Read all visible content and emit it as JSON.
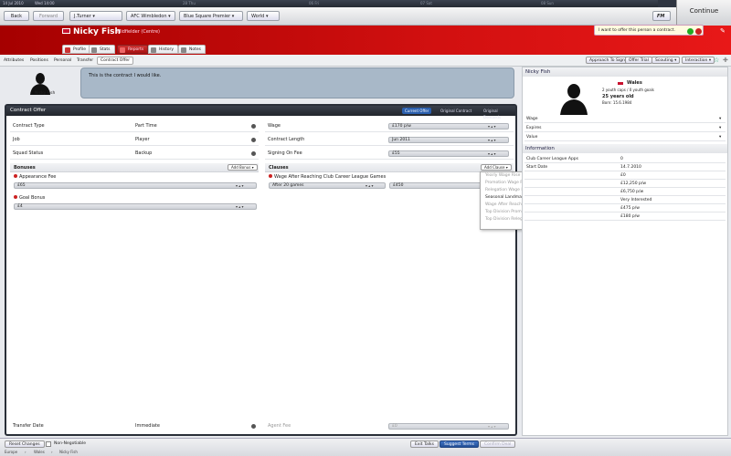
{
  "topbar": {
    "date": "14 Jul 2010",
    "time": "Wed 14:00",
    "timeline": [
      "28 Thu",
      "06 Fri",
      "07 Sat",
      "08 Sun"
    ]
  },
  "nav": {
    "back": "Back",
    "forward": "Forward",
    "manager": "J.Turner",
    "club": "AFC Wimbledon",
    "league": "Blue Square Premier",
    "world": "World",
    "fm_menu": "FM",
    "continue": "Continue"
  },
  "player": {
    "name": "Nicky Fish",
    "position": "Midfielder (Centre)",
    "nation": "Wales",
    "caps": "2 youth caps / 0 youth goals",
    "age": "25 years old",
    "born": "Born: 15.6.1984"
  },
  "profile_tabs": [
    "Profile",
    "Stats",
    "Reports",
    "History",
    "Notes"
  ],
  "notice": "I want to offer this person a contract.",
  "subnav": {
    "items": [
      "Attributes",
      "Positions",
      "Personal",
      "Transfer",
      "Contract Offer"
    ],
    "buttons": [
      "Approach To Sign",
      "Offer Trial",
      "Scouting",
      "Interaction"
    ]
  },
  "speech": "This is the contract I would like.",
  "contract": {
    "title": "Contract Offer",
    "tabs": [
      "Current Offer",
      "Original Contract",
      "Original Demands"
    ],
    "left_rows": [
      {
        "label": "Contract Type",
        "value": "Part Time"
      },
      {
        "label": "Job",
        "value": "Player"
      },
      {
        "label": "Squad Status",
        "value": "Backup"
      }
    ],
    "right_rows": [
      {
        "label": "Wage",
        "value": "£170 p/w"
      },
      {
        "label": "Contract Length",
        "value": "Jun 2011"
      },
      {
        "label": "Signing On Fee",
        "value": "£55"
      }
    ],
    "bonuses": {
      "title": "Bonuses",
      "add": "Add Bonus",
      "items": [
        {
          "label": "Appearance Fee",
          "value": "£65"
        },
        {
          "label": "Goal Bonus",
          "value": "£4"
        }
      ]
    },
    "clauses": {
      "title": "Clauses",
      "add": "Add Clause",
      "item_label": "Wage After Reaching Club Career League Games",
      "item_condition": "After 20 games",
      "item_value": "£450"
    },
    "dropdown": [
      {
        "label": "Yearly Wage Rise",
        "enabled": false
      },
      {
        "label": "Promotion Wage Rise",
        "enabled": false
      },
      {
        "label": "Relegation Wage Drop",
        "enabled": false
      },
      {
        "label": "Seasonal Landmark Goal Bonus",
        "enabled": true
      },
      {
        "label": "Wage After Reaching Club Career League Games",
        "enabled": false
      },
      {
        "label": "Top Division Promotion Wage Rise",
        "enabled": false
      },
      {
        "label": "Top Division Relegation Wage Drop",
        "enabled": false
      }
    ],
    "transfer_date_label": "Transfer Date",
    "transfer_date_value": "Immediate",
    "agent_fee_label": "Agent Fee",
    "agent_fee_value": "£0"
  },
  "right_panel": {
    "kv_top": [
      {
        "k": "Wage",
        "v": ""
      },
      {
        "k": "Expires",
        "v": ""
      },
      {
        "k": "Value",
        "v": ""
      }
    ],
    "info_title": "Information",
    "info": [
      {
        "k": "Club Career League Apps",
        "v": "0"
      },
      {
        "k": "Start Date",
        "v": "14.7.2010"
      },
      {
        "k": "",
        "v": "£0"
      },
      {
        "k": "",
        "v": "£12,250 p/w"
      },
      {
        "k": "",
        "v": "£6,750 p/w"
      },
      {
        "k": "",
        "v": "Very Interested"
      },
      {
        "k": "",
        "v": "£475 p/w"
      },
      {
        "k": "",
        "v": "£180 p/w"
      }
    ]
  },
  "bottom": {
    "reset": "Reset Changes",
    "non_negotiable": "Non-Negotiable",
    "exit": "Exit Talks",
    "suggest": "Suggest Terms",
    "confirm": "Confirm Deal",
    "breadcrumb": [
      "Europe",
      "Wales",
      "Nicky Fish"
    ]
  }
}
